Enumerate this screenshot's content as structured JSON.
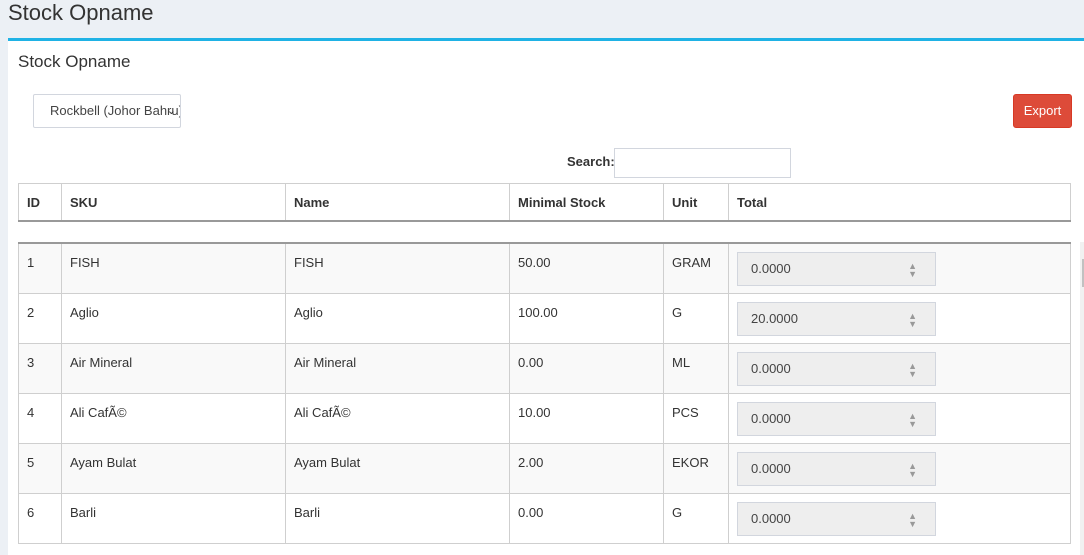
{
  "page": {
    "title": "Stock Opname"
  },
  "box": {
    "title": "Stock Opname",
    "store_select": {
      "selected": "Rockbell (Johor Bahru)"
    },
    "export_label": "Export",
    "search_label": "Search:",
    "search_value": ""
  },
  "table": {
    "columns": [
      "ID",
      "SKU",
      "Name",
      "Minimal Stock",
      "Unit",
      "Total"
    ],
    "rows": [
      {
        "id": "1",
        "sku": "FISH",
        "name": "FISH",
        "min": "50.00",
        "unit": "GRAM",
        "total": "0.0000"
      },
      {
        "id": "2",
        "sku": "Aglio",
        "name": "Aglio",
        "min": "100.00",
        "unit": "G",
        "total": "20.0000"
      },
      {
        "id": "3",
        "sku": "Air Mineral",
        "name": "Air Mineral",
        "min": "0.00",
        "unit": "ML",
        "total": "0.0000"
      },
      {
        "id": "4",
        "sku": "Ali CafÃ©",
        "name": "Ali CafÃ©",
        "min": "10.00",
        "unit": "PCS",
        "total": "0.0000"
      },
      {
        "id": "5",
        "sku": "Ayam Bulat",
        "name": "Ayam Bulat",
        "min": "2.00",
        "unit": "EKOR",
        "total": "0.0000"
      },
      {
        "id": "6",
        "sku": "Barli",
        "name": "Barli",
        "min": "0.00",
        "unit": "G",
        "total": "0.0000"
      }
    ]
  },
  "colors": {
    "accent": "#1fb2e5",
    "export": "#dd4b39"
  }
}
